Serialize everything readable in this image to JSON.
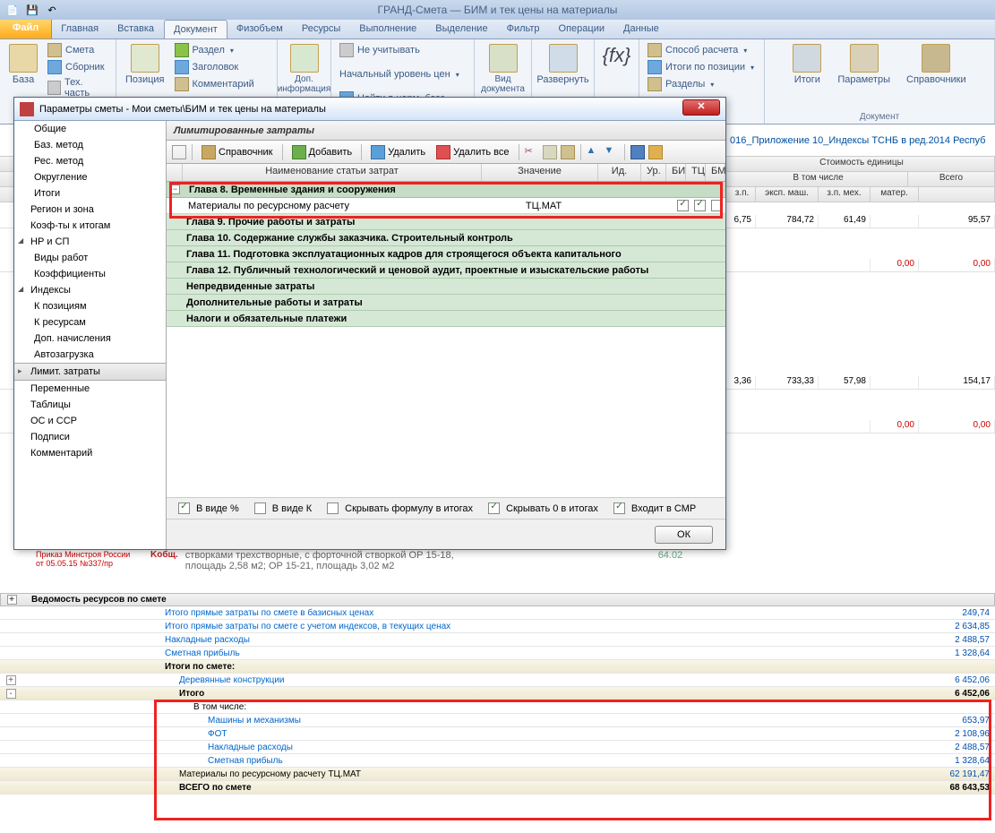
{
  "titlebar": {
    "text": "ГРАНД-Смета — БИМ и тек цены на материалы"
  },
  "menu": {
    "file": "Файл",
    "tabs": [
      "Главная",
      "Вставка",
      "Документ",
      "Физобъем",
      "Ресурсы",
      "Выполнение",
      "Выделение",
      "Фильтр",
      "Операции",
      "Данные"
    ],
    "active": 2
  },
  "ribbon": {
    "g1": {
      "big": "База",
      "i1": "Смета",
      "i2": "Сборник",
      "i3": "Тех. часть"
    },
    "g2": {
      "big": "Позиция",
      "i1": "Раздел",
      "i2": "Заголовок",
      "i3": "Комментарий"
    },
    "g3": {
      "big": "Доп. информация"
    },
    "g4": {
      "i1": "Не учитывать",
      "i2": "Начальный уровень цен",
      "i3": "Найти в норм. базе"
    },
    "g5": {
      "big": "Вид документа"
    },
    "g6": {
      "big": "Развернуть"
    },
    "g7": {
      "big": "{fx}"
    },
    "g8": {
      "i1": "Способ расчета",
      "i2": "Итоги по позиции",
      "i3": "Разделы"
    },
    "g9": {
      "b1": "Итоги",
      "b2": "Параметры",
      "b3": "Справочники",
      "label": "Документ"
    }
  },
  "dialog": {
    "title": "Параметры сметы - Мои сметы\\БИМ и тек цены на материалы",
    "sidebar": [
      {
        "t": "Общие",
        "l": 1
      },
      {
        "t": "Баз. метод",
        "l": 1
      },
      {
        "t": "Рес. метод",
        "l": 1
      },
      {
        "t": "Округление",
        "l": 1
      },
      {
        "t": "Итоги",
        "l": 1
      },
      {
        "t": "Регион и зона",
        "l": 0
      },
      {
        "t": "Коэф-ты к итогам",
        "l": 0
      },
      {
        "t": "НР и СП",
        "l": 0,
        "exp": "o"
      },
      {
        "t": "Виды работ",
        "l": 1
      },
      {
        "t": "Коэффициенты",
        "l": 1
      },
      {
        "t": "Индексы",
        "l": 0,
        "exp": "o"
      },
      {
        "t": "К позициям",
        "l": 1
      },
      {
        "t": "К ресурсам",
        "l": 1
      },
      {
        "t": "Доп. начисления",
        "l": 1
      },
      {
        "t": "Автозагрузка",
        "l": 1
      },
      {
        "t": "Лимит. затраты",
        "l": 0,
        "sel": true,
        "exp": "c"
      },
      {
        "t": "Переменные",
        "l": 0
      },
      {
        "t": "Таблицы",
        "l": 0
      },
      {
        "t": "ОС и ССР",
        "l": 0
      },
      {
        "t": "Подписи",
        "l": 0
      },
      {
        "t": "Комментарий",
        "l": 0
      }
    ],
    "header": "Лимитированные затраты",
    "toolbar": {
      "t1": "Справочник",
      "t2": "Добавить",
      "t3": "Удалить",
      "t4": "Удалить все"
    },
    "gridhead": {
      "c1": "Наименование статьи затрат",
      "c2": "Значение",
      "c3": "Ид.",
      "c4": "Ур.",
      "c5": "БИ",
      "c6": "ТЦ",
      "c7": "БМ"
    },
    "rows": [
      {
        "type": "ch",
        "name": "Глава 8. Временные здания и сооружения",
        "exp": "-"
      },
      {
        "type": "data",
        "name": "Материалы по ресурсному расчету",
        "val": "ТЦ.МАТ",
        "c1": true,
        "c2": true,
        "c3": false
      },
      {
        "type": "ch2",
        "name": "Глава 9. Прочие работы и затраты"
      },
      {
        "type": "ch2",
        "name": "Глава 10. Содержание службы заказчика. Строительный контроль"
      },
      {
        "type": "ch2",
        "name": "Глава 11. Подготовка эксплуатационных кадров для строящегося объекта капитального"
      },
      {
        "type": "ch2",
        "name": "Глава 12. Публичный технологический и ценовой аудит, проектные и изыскательские работы"
      },
      {
        "type": "ch2",
        "name": "Непредвиденные затраты"
      },
      {
        "type": "ch2",
        "name": "Дополнительные работы и затраты"
      },
      {
        "type": "ch2",
        "name": "Налоги и обязательные платежи"
      }
    ],
    "footer": {
      "o1": "В виде %",
      "o2": "В виде К",
      "o3": "Скрывать формулу в итогах",
      "o4": "Скрывать 0 в итогах",
      "o5": "Входит в СМР",
      "ok": "ОК"
    }
  },
  "bg": {
    "pathfrag": "016_Приложение 10_Индексы ТСНБ в ред.2014 Респуб",
    "head1": {
      "c1": "Стоимость единицы",
      "c2": "В том числе",
      "c3": "Всего"
    },
    "head2": {
      "c1": "з.п.",
      "c2": "эксп. маш.",
      "c3": "з.п. мех.",
      "c4": "матер."
    },
    "vals1": {
      "a": "6,75",
      "b": "784,72",
      "c": "61,49",
      "d": "95,57"
    },
    "vals2": {
      "a": "0,00",
      "b": "0,00"
    },
    "vals3": {
      "a": "3,36",
      "b": "733,33",
      "c": "57,98",
      "d": "154,17"
    },
    "vals4": {
      "a": "0,00",
      "b": "0,00"
    },
    "frag1": "створками трехстворные, с форточной створкой ОР 15-18,",
    "frag2": "площадь 2,58 м2; ОР 15-21, площадь 3,02 м2",
    "frag3": "Приказ Минстроя России",
    "frag4": "от 05.05.15 №337/пр",
    "frag5": "64.02",
    "kob": "Kобщ."
  },
  "bottom": {
    "title": "Ведомость ресурсов по смете",
    "rows": [
      {
        "name": "Итого прямые затраты по смете в базисных ценах",
        "val": "249,74",
        "lnk": true
      },
      {
        "name": "Итого прямые затраты по смете с учетом индексов, в текущих ценах",
        "val": "2 634,85",
        "lnk": true
      },
      {
        "name": "Накладные расходы",
        "val": "2 488,57",
        "lnk": true
      },
      {
        "name": "Сметная прибыль",
        "val": "1 328,64",
        "lnk": true
      },
      {
        "name": "Итоги по смете:",
        "val": "",
        "bold": true,
        "band": true
      },
      {
        "name": "Деревянные конструкции",
        "val": "6 452,06",
        "lnk": true,
        "indent": 1,
        "tree": "+"
      },
      {
        "name": "Итого",
        "val": "6 452,06",
        "bold": true,
        "band": true,
        "indent": 1,
        "tree": "-"
      },
      {
        "name": "В том числе:",
        "val": "",
        "indent": 2
      },
      {
        "name": "Машины и механизмы",
        "val": "653,97",
        "lnk": true,
        "indent": 3
      },
      {
        "name": "ФОТ",
        "val": "2 108,96",
        "lnk": true,
        "indent": 3
      },
      {
        "name": "Накладные расходы",
        "val": "2 488,57",
        "lnk": true,
        "indent": 3
      },
      {
        "name": "Сметная прибыль",
        "val": "1 328,64",
        "lnk": true,
        "indent": 3
      },
      {
        "name": "Материалы по ресурсному расчету ТЦ.МАТ",
        "val": "62 191,47",
        "indent": 1,
        "band": true
      },
      {
        "name": "ВСЕГО по смете",
        "val": "68 643,53",
        "bold": true,
        "band": true,
        "indent": 1
      }
    ]
  }
}
